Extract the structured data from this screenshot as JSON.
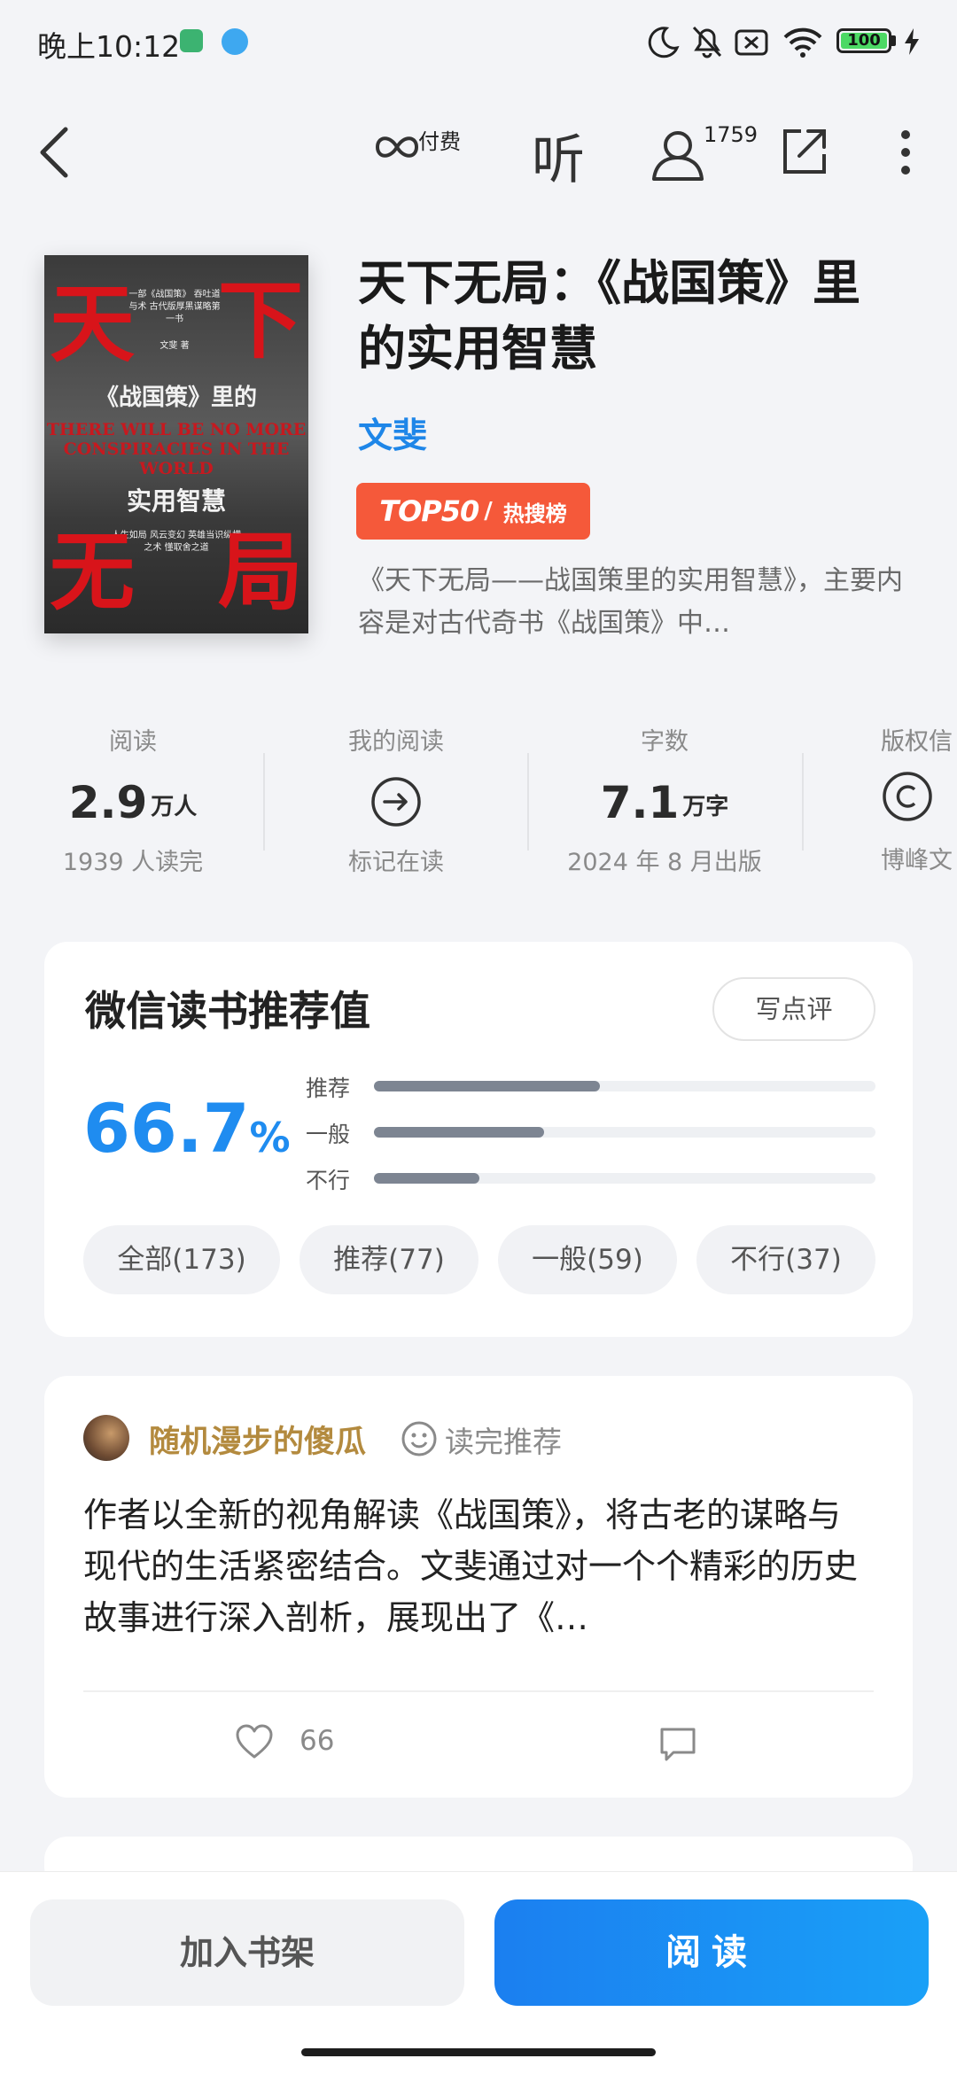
{
  "status_bar": {
    "time": "晚上10:12",
    "battery": "100"
  },
  "nav": {
    "paid_label": "付费",
    "listen_label": "听",
    "reader_count": "1759"
  },
  "book": {
    "title": "天下无局：《战国策》里的实用智慧",
    "author": "文斐",
    "rank_badge": {
      "top": "TOP50",
      "label": "热搜榜"
    },
    "intro": "《天下无局——战国策里的实用智慧》，主要内容是对古代奇书《战国策》中…",
    "cover": {
      "char1": "天",
      "char2": "下",
      "char3": "无",
      "char4": "局",
      "tagline": "一部《战国策》 吞吐道与术 古代版厚黑谋略第一书",
      "author_line": "文斐 著",
      "subtitle1": "《战国策》里的",
      "english": "THERE WILL BE NO MORE CONSPIRACIES IN THE WORLD",
      "subtitle2": "实用智慧",
      "lines": "人生如局 风云变幻 英雄当识纵横之术 懂取舍之道"
    }
  },
  "stats": [
    {
      "label": "阅读",
      "value": "2.9",
      "unit": "万人",
      "sub": "1939 人读完"
    },
    {
      "label": "我的阅读",
      "icon": "arrow-circle-icon",
      "sub": "标记在读"
    },
    {
      "label": "字数",
      "value": "7.1",
      "unit": "万字",
      "sub": "2024 年 8 月出版"
    },
    {
      "label": "版权信",
      "icon": "copyright-icon",
      "sub": "博峰文"
    }
  ],
  "recommend": {
    "title": "微信读书推荐值",
    "write_button": "写点评",
    "percent": "66.7",
    "percent_sign": "%",
    "bars": [
      {
        "label": "推荐",
        "fraction": 0.45
      },
      {
        "label": "一般",
        "fraction": 0.34
      },
      {
        "label": "不行",
        "fraction": 0.21
      }
    ],
    "filters": [
      "全部(173)",
      "推荐(77)",
      "一般(59)",
      "不行(37)"
    ]
  },
  "review": {
    "user": "随机漫步的傻瓜",
    "tag": "读完推荐",
    "text": "作者以全新的视角解读《战国策》，将古老的谋略与现代的生活紧密结合。文斐通过对一个个精彩的历史故事进行深入剖析，展现出了《…",
    "likes": "66"
  },
  "bottom": {
    "shelf_button": "加入书架",
    "read_button": "阅读"
  },
  "colors": {
    "accent": "#1f8cf0",
    "badge": "#f5593a",
    "author": "#1e86e8",
    "user": "#b38a3e"
  }
}
